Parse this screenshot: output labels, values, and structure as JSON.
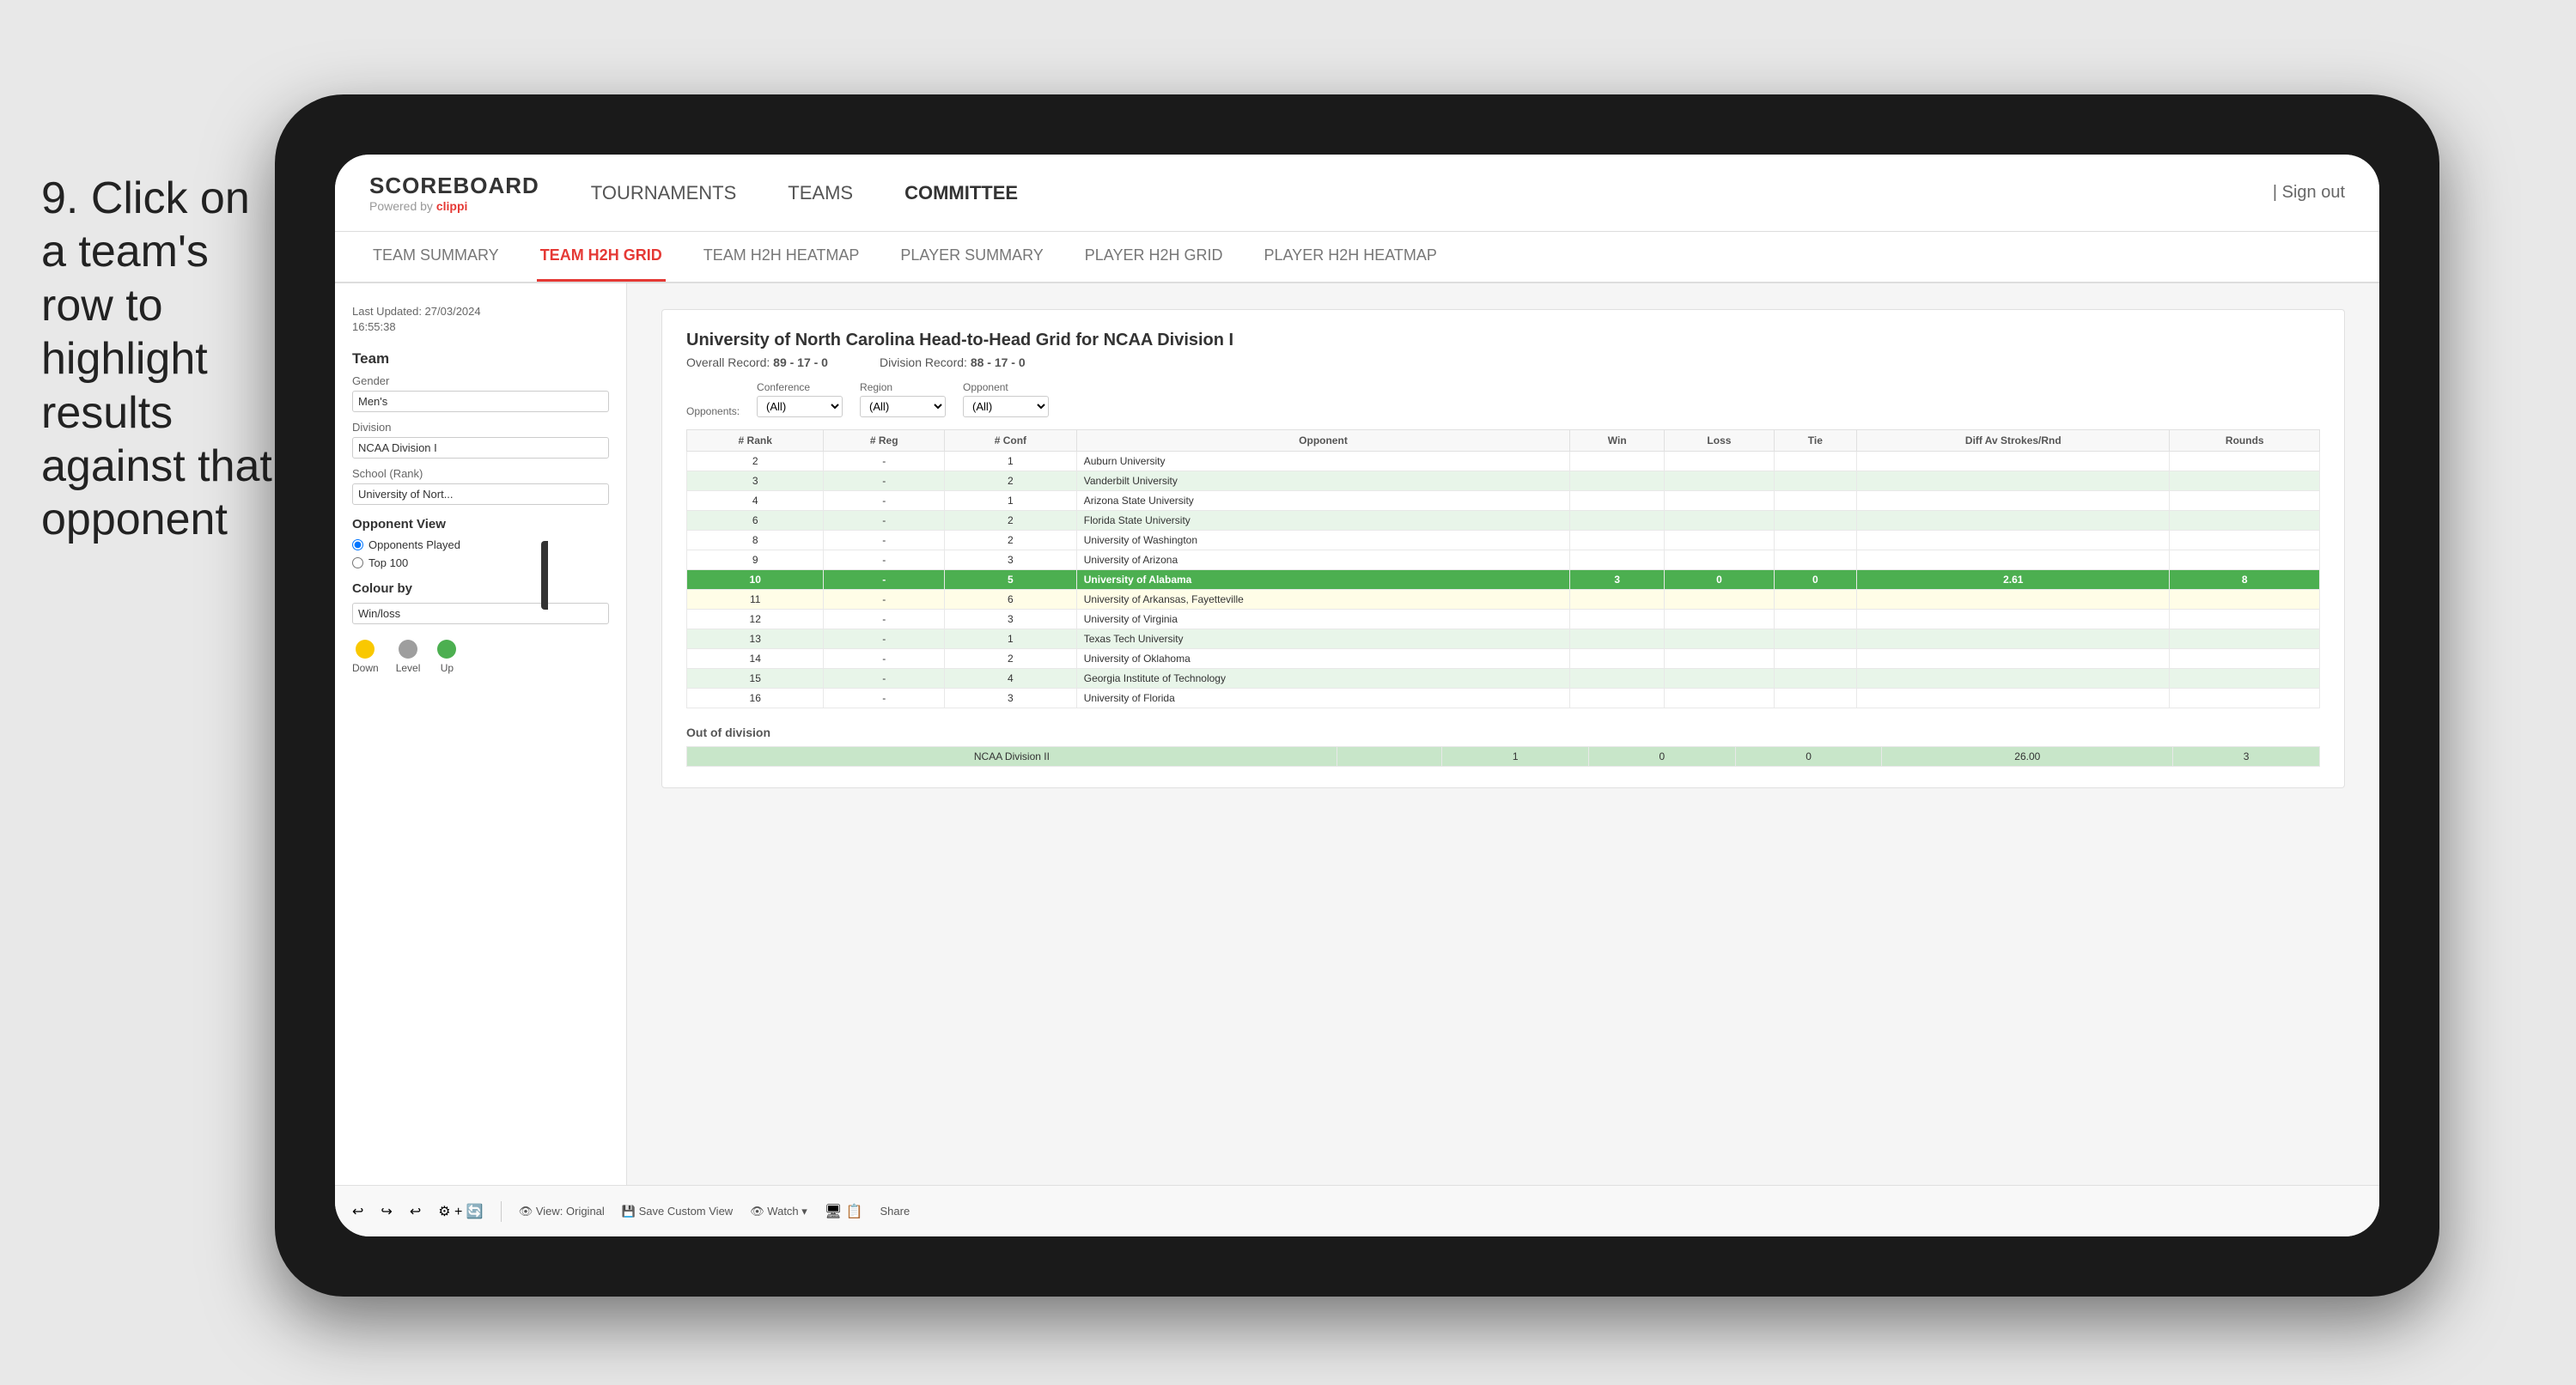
{
  "instruction": {
    "step": "9.",
    "text": "Click on a team's row to highlight results against that opponent"
  },
  "nav": {
    "logo": "SCOREBOARD",
    "powered_by": "Powered by clippi",
    "links": [
      "TOURNAMENTS",
      "TEAMS",
      "COMMITTEE"
    ],
    "sign_out": "| Sign out"
  },
  "sub_nav": {
    "links": [
      "TEAM SUMMARY",
      "TEAM H2H GRID",
      "TEAM H2H HEATMAP",
      "PLAYER SUMMARY",
      "PLAYER H2H GRID",
      "PLAYER H2H HEATMAP"
    ],
    "active": "TEAM H2H GRID"
  },
  "left_panel": {
    "last_updated_label": "Last Updated: 27/03/2024",
    "last_updated_time": "16:55:38",
    "team_label": "Team",
    "gender_label": "Gender",
    "gender_value": "Men's",
    "division_label": "Division",
    "division_value": "NCAA Division I",
    "school_label": "School (Rank)",
    "school_value": "University of Nort...",
    "opponent_view_label": "Opponent View",
    "radio_options": [
      "Opponents Played",
      "Top 100"
    ],
    "radio_active": "Opponents Played",
    "colour_by_label": "Colour by",
    "colour_by_value": "Win/loss",
    "legend": [
      {
        "label": "Down",
        "color": "#f9c800"
      },
      {
        "label": "Level",
        "color": "#9e9e9e"
      },
      {
        "label": "Up",
        "color": "#4caf50"
      }
    ]
  },
  "scoreboard": {
    "title": "University of North Carolina Head-to-Head Grid for NCAA Division I",
    "overall_record_label": "Overall Record:",
    "overall_record": "89 - 17 - 0",
    "division_record_label": "Division Record:",
    "division_record": "88 - 17 - 0",
    "filters": {
      "opponents_label": "Opponents:",
      "conference_label": "Conference",
      "conference_value": "(All)",
      "region_label": "Region",
      "region_value": "(All)",
      "opponent_label": "Opponent",
      "opponent_value": "(All)"
    },
    "table_headers": [
      "# Rank",
      "# Reg",
      "# Conf",
      "Opponent",
      "Win",
      "Loss",
      "Tie",
      "Diff Av Strokes/Rnd",
      "Rounds"
    ],
    "rows": [
      {
        "rank": "2",
        "reg": "-",
        "conf": "1",
        "opponent": "Auburn University",
        "win": "",
        "loss": "",
        "tie": "",
        "diff": "",
        "rounds": "",
        "style": "normal"
      },
      {
        "rank": "3",
        "reg": "-",
        "conf": "2",
        "opponent": "Vanderbilt University",
        "win": "",
        "loss": "",
        "tie": "",
        "diff": "",
        "rounds": "",
        "style": "green-light"
      },
      {
        "rank": "4",
        "reg": "-",
        "conf": "1",
        "opponent": "Arizona State University",
        "win": "",
        "loss": "",
        "tie": "",
        "diff": "",
        "rounds": "",
        "style": "normal"
      },
      {
        "rank": "6",
        "reg": "-",
        "conf": "2",
        "opponent": "Florida State University",
        "win": "",
        "loss": "",
        "tie": "",
        "diff": "",
        "rounds": "",
        "style": "green-light"
      },
      {
        "rank": "8",
        "reg": "-",
        "conf": "2",
        "opponent": "University of Washington",
        "win": "",
        "loss": "",
        "tie": "",
        "diff": "",
        "rounds": "",
        "style": "normal"
      },
      {
        "rank": "9",
        "reg": "-",
        "conf": "3",
        "opponent": "University of Arizona",
        "win": "",
        "loss": "",
        "tie": "",
        "diff": "",
        "rounds": "",
        "style": "normal"
      },
      {
        "rank": "10",
        "reg": "-",
        "conf": "5",
        "opponent": "University of Alabama",
        "win": "3",
        "loss": "0",
        "tie": "0",
        "diff": "2.61",
        "rounds": "8",
        "style": "highlighted"
      },
      {
        "rank": "11",
        "reg": "-",
        "conf": "6",
        "opponent": "University of Arkansas, Fayetteville",
        "win": "",
        "loss": "",
        "tie": "",
        "diff": "",
        "rounds": "",
        "style": "yellow-light"
      },
      {
        "rank": "12",
        "reg": "-",
        "conf": "3",
        "opponent": "University of Virginia",
        "win": "",
        "loss": "",
        "tie": "",
        "diff": "",
        "rounds": "",
        "style": "normal"
      },
      {
        "rank": "13",
        "reg": "-",
        "conf": "1",
        "opponent": "Texas Tech University",
        "win": "",
        "loss": "",
        "tie": "",
        "diff": "",
        "rounds": "",
        "style": "green-light"
      },
      {
        "rank": "14",
        "reg": "-",
        "conf": "2",
        "opponent": "University of Oklahoma",
        "win": "",
        "loss": "",
        "tie": "",
        "diff": "",
        "rounds": "",
        "style": "normal"
      },
      {
        "rank": "15",
        "reg": "-",
        "conf": "4",
        "opponent": "Georgia Institute of Technology",
        "win": "",
        "loss": "",
        "tie": "",
        "diff": "",
        "rounds": "",
        "style": "green-light"
      },
      {
        "rank": "16",
        "reg": "-",
        "conf": "3",
        "opponent": "University of Florida",
        "win": "",
        "loss": "",
        "tie": "",
        "diff": "",
        "rounds": "",
        "style": "normal"
      }
    ],
    "out_of_division_label": "Out of division",
    "out_of_division_row": {
      "label": "NCAA Division II",
      "win": "1",
      "loss": "0",
      "tie": "0",
      "diff": "26.00",
      "rounds": "3"
    }
  },
  "toolbar": {
    "buttons": [
      "View: Original",
      "Save Custom View",
      "Watch ▾",
      "Share"
    ]
  }
}
